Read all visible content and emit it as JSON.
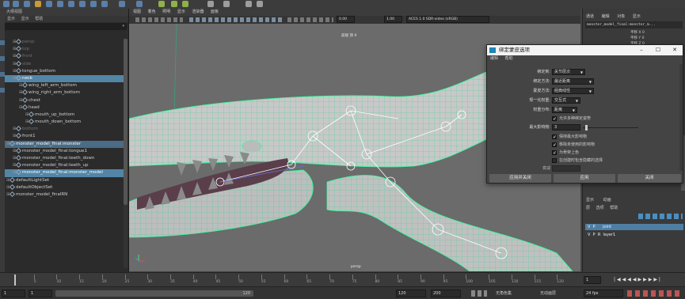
{
  "outliner": {
    "title": "大纲视图",
    "menu": [
      "显示",
      "显示",
      "帮助"
    ],
    "items": [
      {
        "label": "persp",
        "indent": 1,
        "style": "dim"
      },
      {
        "label": "top",
        "indent": 1,
        "style": "dim"
      },
      {
        "label": "front",
        "indent": 1,
        "style": "dim"
      },
      {
        "label": "side",
        "indent": 1,
        "style": "dim"
      },
      {
        "label": "tongue_bottom",
        "indent": 1,
        "style": "normal"
      },
      {
        "label": "neck",
        "indent": 1,
        "style": "sel"
      },
      {
        "label": "wing_left_arm_bottom",
        "indent": 2,
        "style": "normal"
      },
      {
        "label": "wing_right_arm_bottom",
        "indent": 2,
        "style": "normal"
      },
      {
        "label": "chest",
        "indent": 2,
        "style": "normal"
      },
      {
        "label": "head",
        "indent": 2,
        "style": "normal"
      },
      {
        "label": "mouth_up_bottom",
        "indent": 3,
        "style": "normal"
      },
      {
        "label": "mouth_down_bottom",
        "indent": 3,
        "style": "normal"
      },
      {
        "label": "bottom",
        "indent": 1,
        "style": "dim"
      },
      {
        "label": "front1",
        "indent": 1,
        "style": "normal"
      },
      {
        "label": "monster_model_final:monster",
        "indent": 0,
        "style": "sel2"
      },
      {
        "label": "monster_model_final:tongue1",
        "indent": 1,
        "style": "normal"
      },
      {
        "label": "monster_model_final:teeth_down",
        "indent": 1,
        "style": "normal"
      },
      {
        "label": "monster_model_final:teeth_up",
        "indent": 1,
        "style": "normal"
      },
      {
        "label": "monster_model_final:monster_model",
        "indent": 1,
        "style": "sel"
      },
      {
        "label": "defaultLightSet",
        "indent": 0,
        "style": "normal"
      },
      {
        "label": "defaultObjectSet",
        "indent": 0,
        "style": "normal"
      },
      {
        "label": "monster_model_finalRN",
        "indent": 0,
        "style": "normal"
      }
    ]
  },
  "viewport": {
    "menu": [
      "视图",
      "着色",
      "照明",
      "显示",
      "渲染器",
      "面板"
    ],
    "exposure": "0.00",
    "gamma": "1.00",
    "color_space": "ACES 1.0 SDR-video (sRGB)",
    "camera_label": "persp",
    "hud_label": "前视 顶 X"
  },
  "right_panel": {
    "tabs": [
      "通道",
      "编辑",
      "对象",
      "显示"
    ],
    "object_name": "monster_model_final:monster_m...",
    "attrs": [
      "平移 X  0",
      "平移 Y  0",
      "平移 Z  0"
    ],
    "layer_tabs": [
      "显示",
      "动画"
    ],
    "layer_menu": [
      "层",
      "选项",
      "帮助"
    ],
    "layers": [
      {
        "v": "V",
        "p": "P",
        "name": "joint",
        "selected": true
      },
      {
        "v": "V",
        "p": "P",
        "r": "R",
        "name": "layer1",
        "selected": false
      }
    ]
  },
  "dialog": {
    "title": "绑定蒙皮选项",
    "menu": [
      "编辑",
      "帮助"
    ],
    "options": [
      {
        "label": "绑定到:",
        "value": "关节层次"
      },
      {
        "label": "绑定方法:",
        "value": "最近距离"
      },
      {
        "label": "蒙皮方法:",
        "value": "经典线性"
      },
      {
        "label": "规一化权重:",
        "value": "交互式"
      },
      {
        "label": "权重分布:",
        "value": "距离"
      }
    ],
    "allow_multiple_bind": "允许多种绑定姿势",
    "max_influence_label": "最大影响物:",
    "max_influence_value": "3",
    "checkboxes": [
      {
        "label": "保持最大影响物",
        "checked": true
      },
      {
        "label": "移除未使用的影响物",
        "checked": true
      },
      {
        "label": "为骨架上色",
        "checked": true
      },
      {
        "label": "在创建时包含隐藏的选择",
        "checked": false
      }
    ],
    "falloff_label": "衰减",
    "buttons": [
      "应用并关闭",
      "应用",
      "关闭"
    ]
  },
  "timeline": {
    "ticks": [
      "5",
      "10",
      "15",
      "20",
      "25",
      "30",
      "35",
      "40",
      "45",
      "50",
      "55",
      "60",
      "65",
      "70",
      "75",
      "80",
      "85",
      "90",
      "95",
      "100",
      "105",
      "110",
      "115",
      "120"
    ],
    "current_frame": "1"
  },
  "range": {
    "start": "1",
    "inner_start": "1",
    "inner_end_marker": "120",
    "end": "120",
    "anim_end": "200",
    "char_set": "无角色集",
    "anim_layer": "无动画层",
    "fps": "24 fps"
  }
}
